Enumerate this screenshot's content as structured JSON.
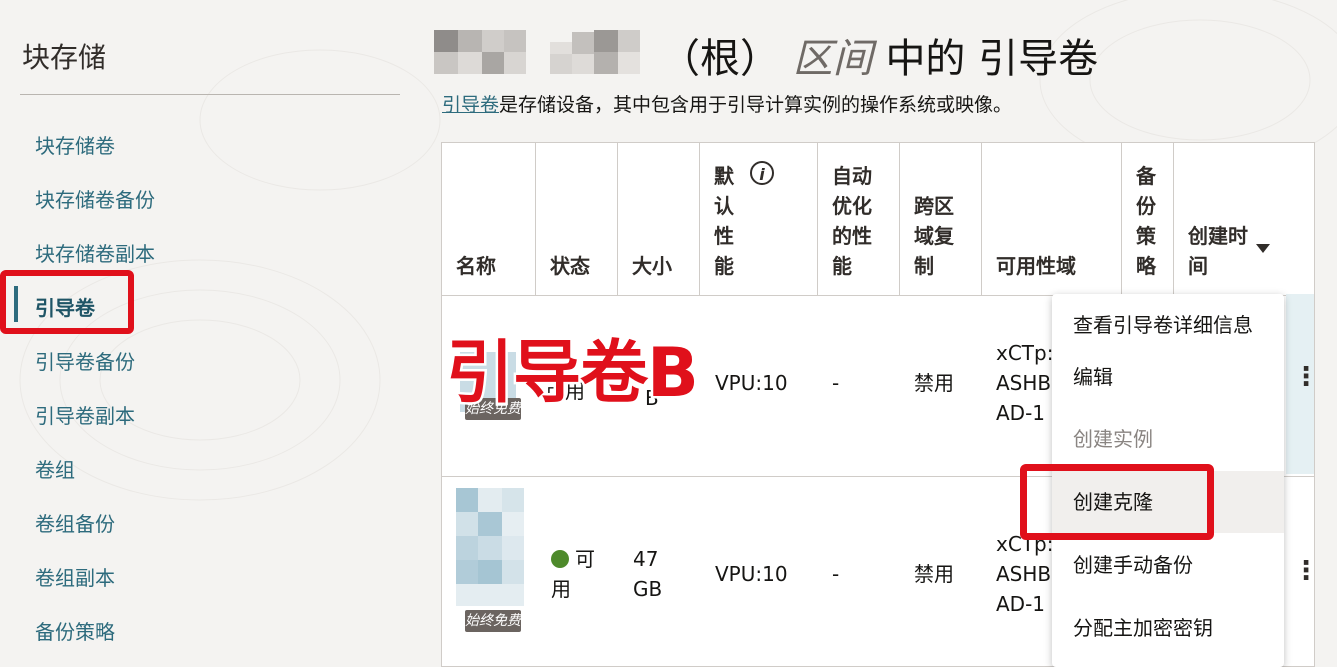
{
  "sidebar": {
    "title": "块存储",
    "items": [
      {
        "label": "块存储卷"
      },
      {
        "label": "块存储卷备份"
      },
      {
        "label": "块存储卷副本"
      },
      {
        "label": "引导卷",
        "active": true
      },
      {
        "label": "引导卷备份"
      },
      {
        "label": "引导卷副本"
      },
      {
        "label": "卷组"
      },
      {
        "label": "卷组备份"
      },
      {
        "label": "卷组副本"
      },
      {
        "label": "备份策略"
      }
    ]
  },
  "header": {
    "title_suffix": "（根）",
    "title_compartment": "区间",
    "title_main": "中的 引导卷",
    "subtitle_link": "引导卷",
    "subtitle_rest": "是存储设备，其中包含用于引导计算实例的操作系统或映像。"
  },
  "table": {
    "columns": {
      "name": "名称",
      "status": "状态",
      "size": "大小",
      "default_perf": "默认性能",
      "auto_tune": "自动优化的性能",
      "cross_region": "跨区域复制",
      "availability_domain": "可用性域",
      "backup_policy": "备份策略",
      "created": "创建时间"
    },
    "rows": [
      {
        "badge": "始终免费",
        "status_partial": "可用",
        "size_partial": "B",
        "vpu": "VPU:10",
        "auto_tune": "-",
        "cross_region": "禁用",
        "ad_line1": "xCTp:",
        "ad_line2": "ASHB",
        "ad_line3": "AD-1"
      },
      {
        "badge": "始终免费",
        "status": "可用",
        "size_num": "47",
        "size_unit": "GB",
        "vpu": "VPU:10",
        "auto_tune": "-",
        "cross_region": "禁用",
        "ad_line1": "xCTp:",
        "ad_line2": "ASHB",
        "ad_line3": "AD-1"
      }
    ]
  },
  "menu": {
    "items": [
      {
        "label": "查看引导卷详细信息"
      },
      {
        "label": "编辑"
      },
      {
        "label": "创建实例",
        "disabled": true
      },
      {
        "label": "创建克隆",
        "highlighted": true
      },
      {
        "label": "创建手动备份"
      },
      {
        "label": "分配主加密密钥"
      }
    ]
  },
  "annotation": {
    "label": "引导卷B",
    "color": "#e0101b"
  },
  "colors": {
    "link": "#2d6b7d",
    "status_available": "#4e8a2b",
    "annotation_red": "#e0101b"
  }
}
